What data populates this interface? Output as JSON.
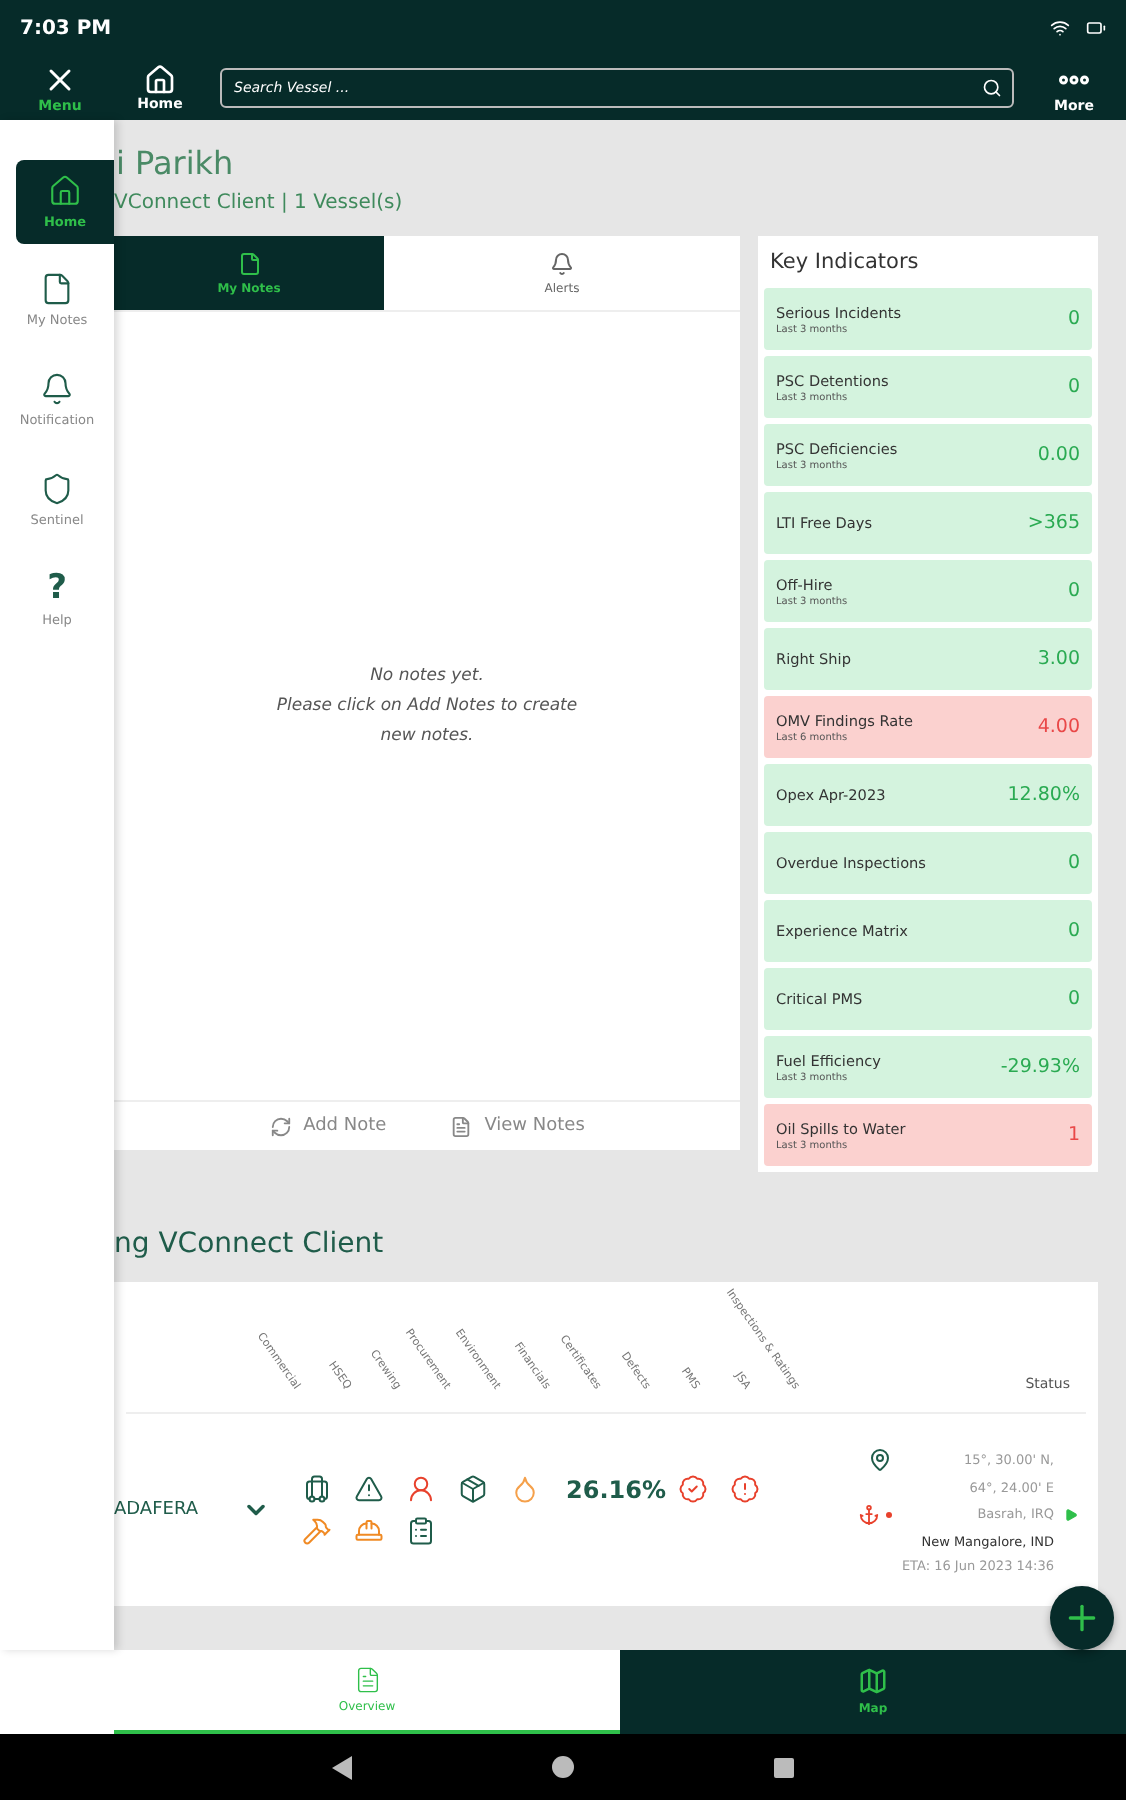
{
  "status_bar": {
    "time": "7:03 PM"
  },
  "top_bar": {
    "menu_label": "Menu",
    "home_label": "Home",
    "search": {
      "placeholder": "Search Vessel ..."
    },
    "more_label": "More"
  },
  "sidebar": {
    "items": [
      {
        "label": "Home",
        "selected": true
      },
      {
        "label": "My Notes",
        "selected": false
      },
      {
        "label": "Notification",
        "selected": false
      },
      {
        "label": "Sentinel",
        "selected": false
      },
      {
        "label": "Help",
        "selected": false,
        "glyph": "?"
      }
    ]
  },
  "header": {
    "name": "i Parikh",
    "subtitle": "VConnect Client | 1 Vessel(s)"
  },
  "notes_card": {
    "tabs": [
      {
        "label": "My Notes",
        "selected": true
      },
      {
        "label": "Alerts",
        "selected": false
      }
    ],
    "empty_message": [
      "No notes yet.",
      "Please click on Add Notes to create",
      "new notes."
    ],
    "actions": [
      "Add Note",
      "View Notes"
    ]
  },
  "key_indicators": {
    "title": "Key Indicators",
    "items": [
      {
        "name": "Serious Incidents",
        "period": "Last 3 months",
        "value": "0",
        "kind": "good"
      },
      {
        "name": "PSC Detentions",
        "period": "Last 3 months",
        "value": "0",
        "kind": "good"
      },
      {
        "name": "PSC Deficiencies",
        "period": "Last 3 months",
        "value": "0.00",
        "kind": "good"
      },
      {
        "name": "LTI Free Days",
        "value": ">365",
        "kind": "good"
      },
      {
        "name": "Off-Hire",
        "period": "Last 3 months",
        "value": "0",
        "kind": "good"
      },
      {
        "name": "Right Ship",
        "value": "3.00",
        "kind": "good"
      },
      {
        "name": "OMV Findings Rate",
        "period": "Last 6 months",
        "value": "4.00",
        "kind": "bad"
      },
      {
        "name": "Opex Apr-2023",
        "value": "12.80%",
        "kind": "good"
      },
      {
        "name": "Overdue Inspections",
        "value": "0",
        "kind": "good"
      },
      {
        "name": "Experience Matrix",
        "value": "0",
        "kind": "good"
      },
      {
        "name": "Critical PMS",
        "value": "0",
        "kind": "good"
      },
      {
        "name": "Fuel Efficiency",
        "period": "Last 3 months",
        "value": "-29.93%",
        "kind": "good"
      },
      {
        "name": "Oil Spills to Water",
        "period": "Last 3 months",
        "value": "1",
        "kind": "bad"
      }
    ]
  },
  "fleet": {
    "title": "ng VConnect Client",
    "columns": [
      "Commercial",
      "HSEQ",
      "Crewing",
      "Procurement",
      "Environment",
      "Financials",
      "Certificates",
      "Defects",
      "PMS",
      "JSA",
      "Inspections & Ratings"
    ],
    "status_header": "Status",
    "rows": [
      {
        "vessel": "ADAFERA",
        "score": "26.16%",
        "modules": [
          {
            "color": "#1f5c4a"
          },
          {
            "color": "#1f5c4a"
          },
          {
            "color": "#e8412c"
          },
          {
            "color": "#1f5c4a"
          },
          {
            "color": "#f5a04a"
          },
          {
            "color": "#e8412c"
          },
          {
            "color": "#e8412c"
          },
          {
            "color": "#f08a24"
          },
          {
            "color": "#f08a24"
          },
          {
            "color": "#1f5c4a"
          }
        ],
        "position": [
          "15°, 30.00' N,",
          "64°, 24.00' E"
        ],
        "from": "Basrah, IRQ",
        "to": "New Mangalore, IND",
        "eta": "ETA: 16 Jun 2023 14:36"
      }
    ]
  },
  "bottom_tabs": [
    {
      "label": "Overview",
      "selected": true
    },
    {
      "label": "Map",
      "selected": false
    }
  ]
}
